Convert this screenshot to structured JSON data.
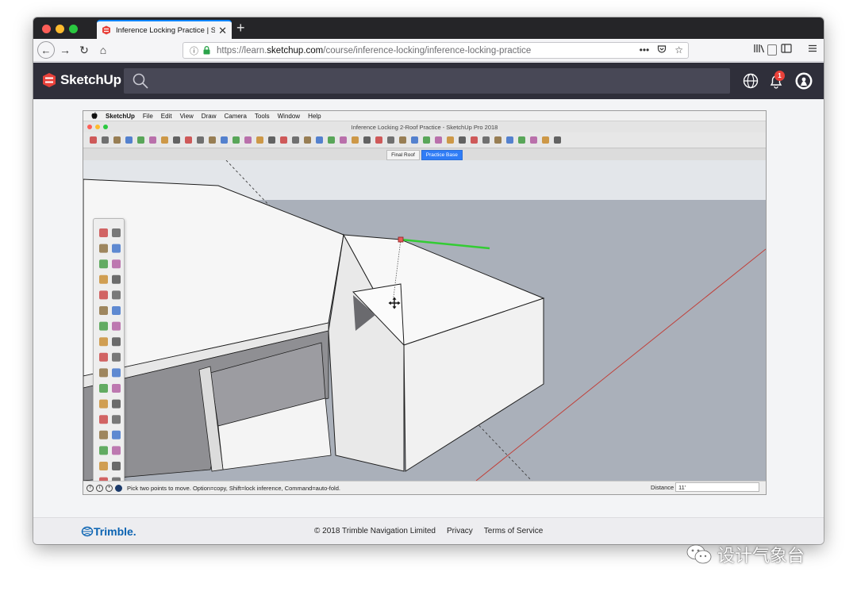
{
  "browser": {
    "tab_title": "Inference Locking Practice | Sk",
    "tab_close": "✕",
    "new_tab": "+",
    "url_prefix": "https://learn.",
    "url_domain": "sketchup.com",
    "url_path": "/course/inference-locking/inference-locking-practice",
    "page_actions": "•••"
  },
  "site": {
    "logo_text": "SketchUp",
    "notification_count": "1"
  },
  "app": {
    "menu": [
      "SketchUp",
      "File",
      "Edit",
      "View",
      "Draw",
      "Camera",
      "Tools",
      "Window",
      "Help"
    ],
    "window_title": "Inference Locking 2-Roof Practice - SketchUp Pro 2018",
    "scenes": [
      "Final Roof",
      "Practice Base"
    ],
    "active_scene": "Practice Base",
    "status_text": "Pick two points to move. Option=copy, Shift=lock inference, Command=auto-fold.",
    "distance_label": "Distance",
    "distance_value": "11'"
  },
  "footer": {
    "brand": "Trimble.",
    "copyright": "© 2018 Trimble Navigation Limited",
    "privacy": "Privacy",
    "terms": "Terms of Service"
  },
  "watermark": {
    "text": "设计气象台"
  },
  "colors": {
    "tab_accent": "#0a84ff",
    "su_red": "#e8413a",
    "su_header": "#2f2f3a",
    "sky": "#e3e6ea",
    "ground": "#aab0ba",
    "axis_green": "#33cc33",
    "axis_red": "#c0403a",
    "trimble_blue": "#0a63b2"
  }
}
